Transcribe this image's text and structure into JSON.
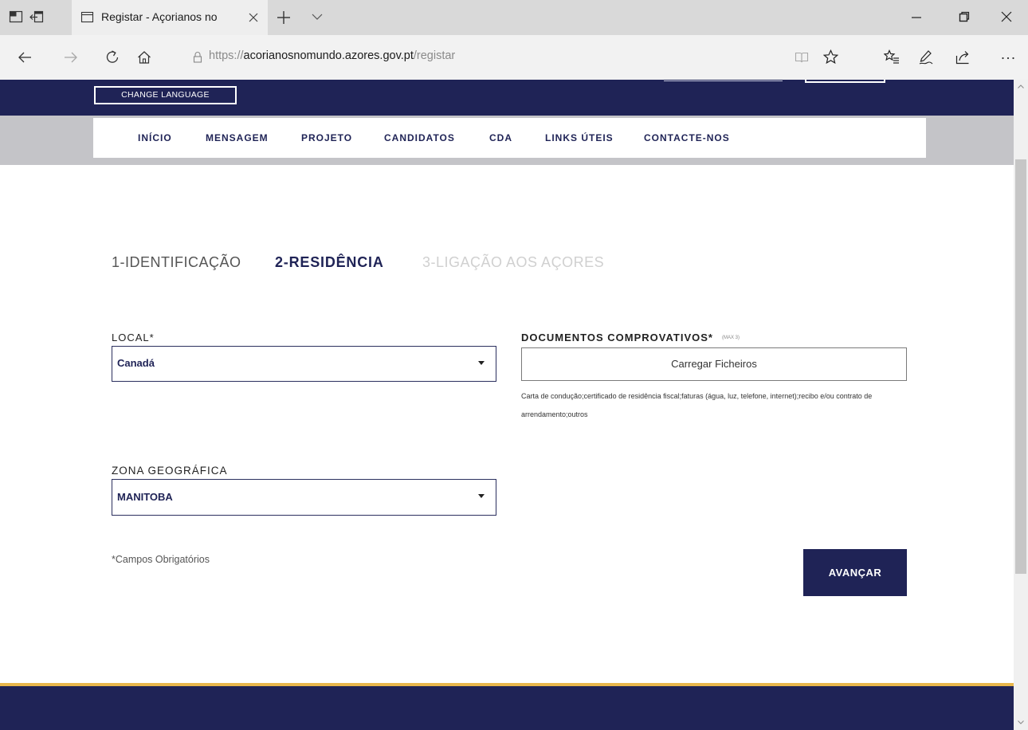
{
  "browser": {
    "tab": {
      "title": "Registar - Açorianos no"
    },
    "address": {
      "scheme": "https://",
      "host": "acorianosnomundo.azores.gov.pt",
      "path": "/registar"
    },
    "icons": [
      "tab-preview-icon",
      "tabs-aside-icon",
      "page-icon",
      "close-tab-icon",
      "new-tab-icon",
      "tab-list-chevron-icon",
      "minimize-icon",
      "restore-icon",
      "close-window-icon",
      "back-icon",
      "forward-icon",
      "refresh-icon",
      "home-icon",
      "lock-icon",
      "reading-view-icon",
      "favorite-star-icon",
      "favorites-hub-icon",
      "pen-icon",
      "share-icon",
      "more-icon"
    ]
  },
  "header": {
    "change_language": "CHANGE LANGUAGE"
  },
  "nav": {
    "items": [
      "INÍCIO",
      "MENSAGEM",
      "PROJETO",
      "CANDIDATOS",
      "CDA",
      "LINKS ÚTEIS",
      "CONTACTE-NOS"
    ]
  },
  "steps": {
    "current_step": 2,
    "items": [
      "1-IDENTIFICAÇÃO",
      "2-RESIDÊNCIA",
      "3-LIGAÇÃO AOS AÇORES"
    ]
  },
  "form": {
    "local": {
      "label": "LOCAL*",
      "value": "Canadá",
      "icon": "caret-down-icon"
    },
    "documents": {
      "label": "DOCUMENTOS COMPROVATIVOS*",
      "limit": "(MAX 3)",
      "upload_label": "Carregar Ficheiros",
      "help": "Carta de condução;certificado de residência fiscal;faturas (água, luz, telefone, internet);recibo e/ou contrato de arrendamento;outros"
    },
    "zone": {
      "label": "ZONA GEOGRÁFICA",
      "value": "MANITOBA",
      "icon": "caret-down-icon"
    },
    "required_note": "*Campos Obrigatórios",
    "submit_label": "AVANÇAR"
  },
  "colors": {
    "navy": "#1f2356",
    "gold": "#e8b74b",
    "band": "#c4c4c8"
  }
}
